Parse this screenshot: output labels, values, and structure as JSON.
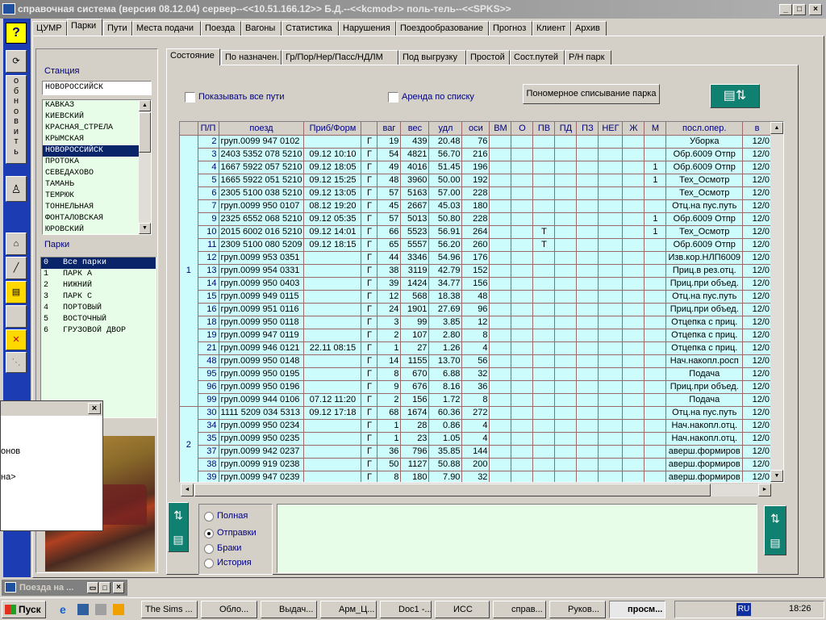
{
  "window": {
    "title": "справочная система (версия 08.12.04) сервер--<<10.51.166.12>> Б.Д.--<<kcmod>> поль-тель--<<SPKS>>"
  },
  "main_tabs": [
    "ЦУМР",
    "Парки",
    "Пути",
    "Места подачи",
    "Поезда",
    "Вагоны",
    "Статистика",
    "Нарушения",
    "Поездообразование",
    "Прогноз",
    "Клиент",
    "Архив"
  ],
  "sub_tabs": [
    "Состояние",
    "По назначен.",
    "Гр/Пор/Нер/Пасс/НДЛМ",
    "Под выгрузку",
    "Простой",
    "Сост.путей",
    "Р/Н парк"
  ],
  "left_toolbar": {
    "help": "?",
    "refresh_label": "о\nб\nн\nо\nв\nи\nт\nь"
  },
  "station": {
    "label": "Станция",
    "value": "НОВОРОССИЙСК",
    "items": [
      "КАВКАЗ",
      "КИЕВСКИЙ",
      "КРАСНАЯ_СТРЕЛА",
      "КРЫМСКАЯ",
      "НОВОРОССИЙСК",
      "ПРОТОКА",
      "СЕВЕДАХОВО",
      "ТАМАНЬ",
      "ТЕМРЮК",
      "ТОННЕЛЬНАЯ",
      "ФОНТАЛОВСКАЯ",
      "ЮРОВСКИЙ"
    ],
    "selected": 4
  },
  "parks": {
    "label": "Парки",
    "items": [
      "0   Все парки",
      "1   ПАРК А",
      "2   НИЖНИЙ",
      "3   ПАРК С",
      "4   ПОРТОВЫЙ",
      "5   ВОСТОЧНЫЙ",
      "6   ГРУЗОВОЙ ДВОР"
    ],
    "selected": 0
  },
  "options": {
    "show_all": "Показывать  все пути",
    "rent": "Аренда по списку",
    "numbering_button": "Пономерное списывание парка"
  },
  "table": {
    "headers": [
      "П/П",
      "поезд",
      "Приб/Форм",
      "",
      "ваг",
      "вес",
      "удл",
      "оси",
      "ВМ",
      "О",
      "ПВ",
      "ПД",
      "ПЗ",
      "НЕГ",
      "Ж",
      "М",
      "посл.опер.",
      "в"
    ],
    "groups": [
      {
        "label": "1",
        "rows": 21
      },
      {
        "label": "2",
        "rows": 6
      }
    ],
    "rows": [
      [
        "2",
        "груп.0099 947 0102",
        "",
        "Г",
        "19",
        "439",
        "20.48",
        "76",
        "",
        "",
        "",
        "",
        "",
        "",
        "",
        "",
        "Уборка",
        "12/0"
      ],
      [
        "3",
        "2403 5352 078 5210",
        "09.12 10:10",
        "Г",
        "54",
        "4821",
        "56.70",
        "216",
        "",
        "",
        "",
        "",
        "",
        "",
        "",
        "",
        "Обр.6009 Отпр",
        "12/0"
      ],
      [
        "4",
        "1667 5922 057 5210",
        "09.12 18:05",
        "Г",
        "49",
        "4016",
        "51.45",
        "196",
        "",
        "",
        "",
        "",
        "",
        "",
        "",
        "1",
        "Обр.6009 Отпр",
        "12/0"
      ],
      [
        "5",
        "1665 5922 051 5210",
        "09.12 15:25",
        "Г",
        "48",
        "3960",
        "50.00",
        "192",
        "",
        "",
        "",
        "",
        "",
        "",
        "",
        "1",
        "Тех_Осмотр",
        "12/0"
      ],
      [
        "6",
        "2305 5100 038 5210",
        "09.12 13:05",
        "Г",
        "57",
        "5163",
        "57.00",
        "228",
        "",
        "",
        "",
        "",
        "",
        "",
        "",
        "",
        "Тех_Осмотр",
        "12/0"
      ],
      [
        "7",
        "груп.0099 950 0107",
        "08.12 19:20",
        "Г",
        "45",
        "2667",
        "45.03",
        "180",
        "",
        "",
        "",
        "",
        "",
        "",
        "",
        "",
        "Отц.на пус.путь",
        "12/0"
      ],
      [
        "9",
        "2325 6552 068 5210",
        "09.12 05:35",
        "Г",
        "57",
        "5013",
        "50.80",
        "228",
        "",
        "",
        "",
        "",
        "",
        "",
        "",
        "1",
        "Обр.6009 Отпр",
        "12/0"
      ],
      [
        "10",
        "2015 6002 016 5210",
        "09.12 14:01",
        "Г",
        "66",
        "5523",
        "56.91",
        "264",
        "",
        "",
        "Т",
        "",
        "",
        "",
        "",
        "1",
        "Тех_Осмотр",
        "12/0"
      ],
      [
        "11",
        "2309 5100 080 5209",
        "09.12 18:15",
        "Г",
        "65",
        "5557",
        "56.20",
        "260",
        "",
        "",
        "Т",
        "",
        "",
        "",
        "",
        "",
        "Обр.6009 Отпр",
        "12/0"
      ],
      [
        "12",
        "груп.0099 953 0351",
        "",
        "Г",
        "44",
        "3346",
        "54.96",
        "176",
        "",
        "",
        "",
        "",
        "",
        "",
        "",
        "",
        "Изв.кор.НЛП6009",
        "12/0"
      ],
      [
        "13",
        "груп.0099 954 0331",
        "",
        "Г",
        "38",
        "3119",
        "42.79",
        "152",
        "",
        "",
        "",
        "",
        "",
        "",
        "",
        "",
        "Приц.в рез.отц.",
        "12/0"
      ],
      [
        "14",
        "груп.0099 950 0403",
        "",
        "Г",
        "39",
        "1424",
        "34.77",
        "156",
        "",
        "",
        "",
        "",
        "",
        "",
        "",
        "",
        "Приц.при объед.",
        "12/0"
      ],
      [
        "15",
        "груп.0099 949 0115",
        "",
        "Г",
        "12",
        "568",
        "18.38",
        "48",
        "",
        "",
        "",
        "",
        "",
        "",
        "",
        "",
        "Отц.на пус.путь",
        "12/0"
      ],
      [
        "16",
        "груп.0099 951 0116",
        "",
        "Г",
        "24",
        "1901",
        "27.69",
        "96",
        "",
        "",
        "",
        "",
        "",
        "",
        "",
        "",
        "Приц.при объед.",
        "12/0"
      ],
      [
        "18",
        "груп.0099 950 0118",
        "",
        "Г",
        "3",
        "99",
        "3.85",
        "12",
        "",
        "",
        "",
        "",
        "",
        "",
        "",
        "",
        "Отцепка с приц.",
        "12/0"
      ],
      [
        "19",
        "груп.0099 947 0119",
        "",
        "Г",
        "2",
        "107",
        "2.80",
        "8",
        "",
        "",
        "",
        "",
        "",
        "",
        "",
        "",
        "Отцепка с приц.",
        "12/0"
      ],
      [
        "21",
        "груп.0099 946 0121",
        "22.11 08:15",
        "Г",
        "1",
        "27",
        "1.26",
        "4",
        "",
        "",
        "",
        "",
        "",
        "",
        "",
        "",
        "Отцепка с приц.",
        "12/0"
      ],
      [
        "48",
        "груп.0099 950 0148",
        "",
        "Г",
        "14",
        "1155",
        "13.70",
        "56",
        "",
        "",
        "",
        "",
        "",
        "",
        "",
        "",
        "Нач.накопл.росп",
        "12/0"
      ],
      [
        "95",
        "груп.0099 950 0195",
        "",
        "Г",
        "8",
        "670",
        "6.88",
        "32",
        "",
        "",
        "",
        "",
        "",
        "",
        "",
        "",
        "Подача",
        "12/0"
      ],
      [
        "96",
        "груп.0099 950 0196",
        "",
        "Г",
        "9",
        "676",
        "8.16",
        "36",
        "",
        "",
        "",
        "",
        "",
        "",
        "",
        "",
        "Приц.при объед.",
        "12/0"
      ],
      [
        "99",
        "груп.0099 944 0106",
        "07.12 11:20",
        "Г",
        "2",
        "156",
        "1.72",
        "8",
        "",
        "",
        "",
        "",
        "",
        "",
        "",
        "",
        "Подача",
        "12/0"
      ],
      [
        "30",
        "1111 5209 034 5313",
        "09.12 17:18",
        "Г",
        "68",
        "1674",
        "60.36",
        "272",
        "",
        "",
        "",
        "",
        "",
        "",
        "",
        "",
        "Отц.на пус.путь",
        "12/0"
      ],
      [
        "34",
        "груп.0099 950 0234",
        "",
        "Г",
        "1",
        "28",
        "0.86",
        "4",
        "",
        "",
        "",
        "",
        "",
        "",
        "",
        "",
        "Нач.накопл.отц.",
        "12/0"
      ],
      [
        "35",
        "груп.0099 950 0235",
        "",
        "Г",
        "1",
        "23",
        "1.05",
        "4",
        "",
        "",
        "",
        "",
        "",
        "",
        "",
        "",
        "Нач.накопл.отц.",
        "12/0"
      ],
      [
        "37",
        "груп.0099 942 0237",
        "",
        "Г",
        "36",
        "796",
        "35.85",
        "144",
        "",
        "",
        "",
        "",
        "",
        "",
        "",
        "",
        "аверш.формиров",
        "12/0"
      ],
      [
        "38",
        "груп.0099 919 0238",
        "",
        "Г",
        "50",
        "1127",
        "50.88",
        "200",
        "",
        "",
        "",
        "",
        "",
        "",
        "",
        "",
        "аверш.формиров",
        "12/0"
      ],
      [
        "39",
        "груп.0099 947 0239",
        "",
        "Г",
        "8",
        "180",
        "7.90",
        "32",
        "",
        "",
        "",
        "",
        "",
        "",
        "",
        "",
        "аверш.формиров",
        "12/0"
      ]
    ]
  },
  "radio": {
    "items": [
      "Полная",
      "Отправки",
      "Браки",
      "История"
    ],
    "selected": 1
  },
  "popup": {
    "close": "×",
    "lines": [
      "онов",
      "на>"
    ]
  },
  "minimized": {
    "title": "Поезда на ..."
  },
  "taskbar": {
    "start": "Пуск",
    "buttons": [
      "The Sims ...",
      "Обло...",
      "Выдач...",
      "Арм_Ц...",
      "Doc1 -...",
      "ИСС",
      "справ...",
      "Руков...",
      "просм..."
    ],
    "lang": "RU",
    "clock": "18:26"
  },
  "colors": {
    "grid_bg": "#ccfcfc",
    "list_bg": "#e8fde8",
    "left_toolbar": "#1c3cb4",
    "selection": "#0a246a"
  }
}
